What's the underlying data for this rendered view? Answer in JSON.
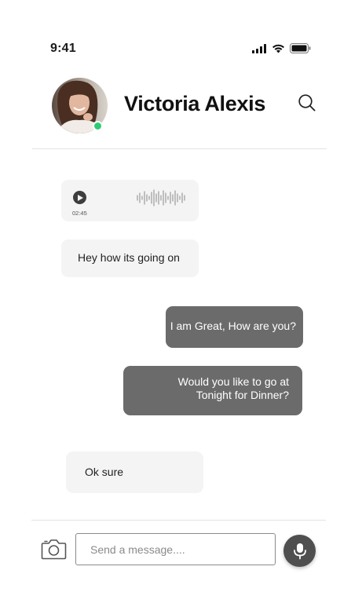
{
  "status_bar": {
    "time": "9:41",
    "icons": [
      "signal-icon",
      "wifi-icon",
      "battery-icon"
    ]
  },
  "header": {
    "contact_name": "Victoria Alexis",
    "online": true,
    "online_color": "#2ecc71",
    "search_icon": "search-icon"
  },
  "messages": [
    {
      "type": "voice",
      "direction": "incoming",
      "duration": "02:45"
    },
    {
      "type": "text",
      "direction": "incoming",
      "text": "Hey how its going on"
    },
    {
      "type": "text",
      "direction": "outgoing",
      "text": "I am Great, How are you?"
    },
    {
      "type": "text",
      "direction": "outgoing",
      "lines": [
        "Would you like to go at",
        "Tonight for Dinner?"
      ]
    },
    {
      "type": "text",
      "direction": "incoming",
      "text": "Ok sure"
    }
  ],
  "composer": {
    "camera_icon": "camera-icon",
    "placeholder": "Send a message....",
    "value": "",
    "mic_icon": "microphone-icon"
  },
  "colors": {
    "incoming_bubble": "#f4f4f4",
    "outgoing_bubble": "#6b6b6b",
    "mic_button": "#4f4f4f"
  }
}
